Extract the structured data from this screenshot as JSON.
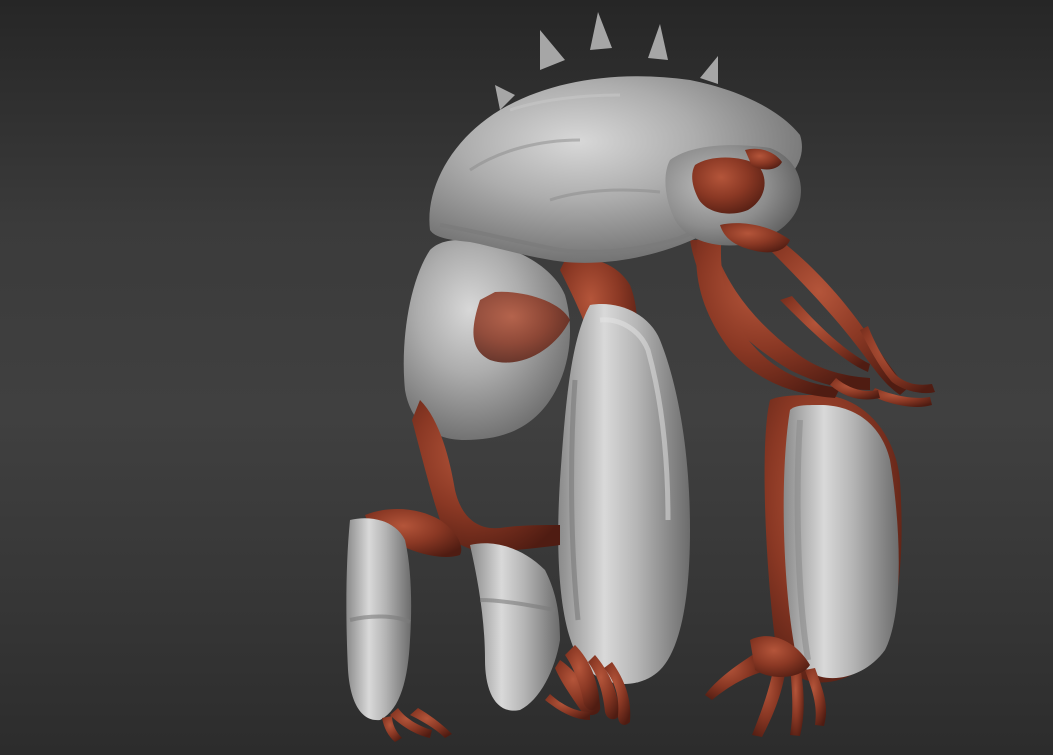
{
  "viewport": {
    "subject": "creature-sculpt",
    "colors": {
      "background_top": "#262626",
      "background_mid": "#404040",
      "background_bottom": "#2c2c2c",
      "skin_gray": "#a9a9a9",
      "flesh_red": "#8e3a26"
    }
  }
}
